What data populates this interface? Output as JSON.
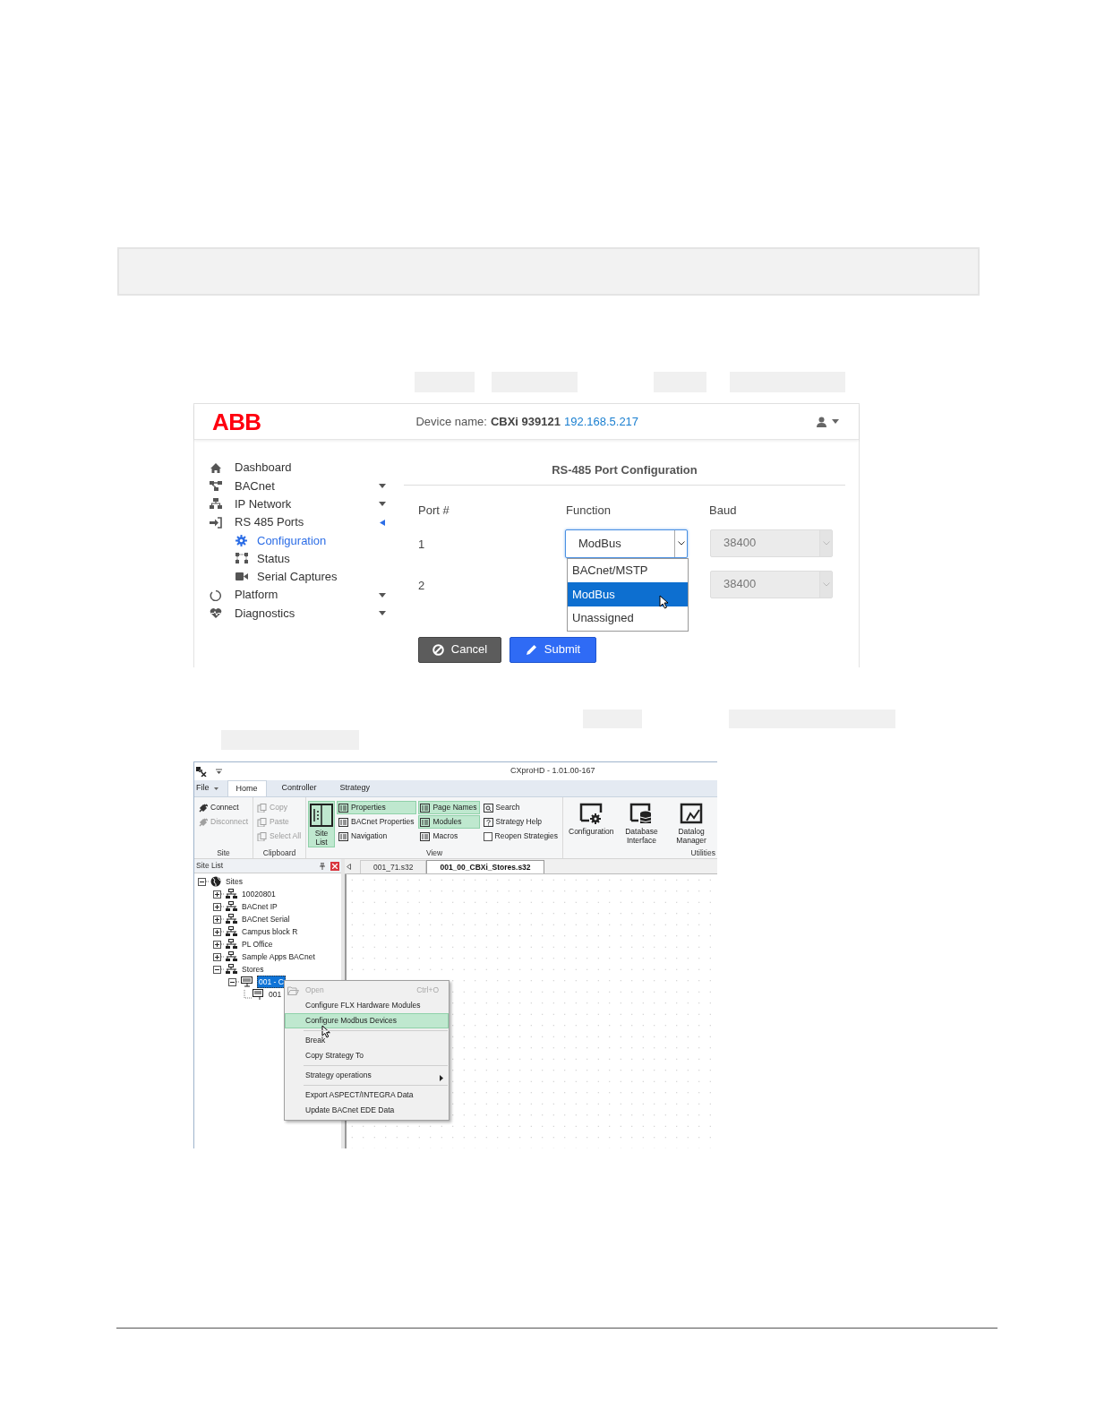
{
  "web_config": {
    "logo": "ABB",
    "header": {
      "device_label": "Device name:",
      "device_name": "CBXi 939121",
      "ip": "192.168.5.217"
    },
    "nav": [
      {
        "label": "Dashboard",
        "kind": "link",
        "selected": false
      },
      {
        "label": "BACnet",
        "kind": "group",
        "expanded": false,
        "selected": false
      },
      {
        "label": "IP Network",
        "kind": "group",
        "expanded": false,
        "selected": false
      },
      {
        "label": "RS 485 Ports",
        "kind": "group",
        "expanded": true,
        "selected": false,
        "children": [
          {
            "label": "Configuration",
            "selected": true
          },
          {
            "label": "Status",
            "selected": false
          },
          {
            "label": "Serial Captures",
            "selected": false
          }
        ]
      },
      {
        "label": "Platform",
        "kind": "group",
        "expanded": false,
        "selected": false
      },
      {
        "label": "Diagnostics",
        "kind": "group",
        "expanded": false,
        "selected": false
      }
    ],
    "title": "RS-485 Port Configuration",
    "columns": [
      "Port #",
      "Function",
      "Baud"
    ],
    "ports": [
      {
        "port": "1",
        "function": "ModBus",
        "baud": "38400",
        "dropdown_open": true
      },
      {
        "port": "2",
        "baud": "38400"
      }
    ],
    "dropdown_options": [
      {
        "label": "BACnet/MSTP",
        "selected": false
      },
      {
        "label": "ModBus",
        "selected": true
      },
      {
        "label": "Unassigned",
        "selected": false
      }
    ],
    "buttons": [
      {
        "label": "Cancel",
        "kind": "cancel"
      },
      {
        "label": "Submit",
        "kind": "submit"
      }
    ]
  },
  "cxpro": {
    "title": "CXproHD - 1.01.00-167",
    "menu_tabs": [
      {
        "label": "File",
        "selected": false
      },
      {
        "label": "Home",
        "selected": true
      },
      {
        "label": "Controller",
        "selected": false
      },
      {
        "label": "Strategy",
        "selected": false
      }
    ],
    "ribbon": [
      {
        "label": "Site",
        "columns": [
          [
            {
              "label": "Connect",
              "kind": "small",
              "disabled": false,
              "highlighted": false
            },
            {
              "label": "Disconnect",
              "kind": "small",
              "disabled": true,
              "highlighted": false
            }
          ]
        ]
      },
      {
        "label": "Clipboard",
        "columns": [
          [
            {
              "label": "Copy",
              "kind": "small",
              "disabled": true,
              "highlighted": false
            },
            {
              "label": "Paste",
              "kind": "small",
              "disabled": true,
              "highlighted": false
            },
            {
              "label": "Select All",
              "kind": "small",
              "disabled": true,
              "highlighted": false
            }
          ]
        ]
      },
      {
        "label": "View",
        "columns": [
          [
            {
              "label": "Site List",
              "kind": "large",
              "disabled": false,
              "highlighted": true
            }
          ],
          [
            {
              "label": "Properties",
              "kind": "small",
              "disabled": false,
              "highlighted": true
            },
            {
              "label": "BACnet Properties",
              "kind": "small",
              "disabled": false,
              "highlighted": false
            },
            {
              "label": "Navigation",
              "kind": "small",
              "disabled": false,
              "highlighted": false
            }
          ],
          [
            {
              "label": "Page Names",
              "kind": "small",
              "disabled": false,
              "highlighted": true
            },
            {
              "label": "Modules",
              "kind": "small",
              "disabled": false,
              "highlighted": true
            },
            {
              "label": "Macros",
              "kind": "small",
              "disabled": false,
              "highlighted": false
            }
          ],
          [
            {
              "label": "Search",
              "kind": "small",
              "disabled": false,
              "highlighted": false
            },
            {
              "label": "Strategy Help",
              "kind": "small",
              "disabled": false,
              "highlighted": false
            },
            {
              "label": "Reopen Strategies",
              "kind": "checkbox",
              "checked": false,
              "disabled": false,
              "highlighted": false
            }
          ]
        ]
      },
      {
        "label": "Utilities",
        "columns": [
          [
            {
              "label": "Configuration",
              "kind": "large",
              "disabled": false,
              "highlighted": false
            }
          ],
          [
            {
              "label": "Database Interface",
              "kind": "large",
              "disabled": false,
              "highlighted": false
            }
          ],
          [
            {
              "label": "Datalog Manager",
              "kind": "large",
              "disabled": false,
              "highlighted": false
            }
          ]
        ]
      }
    ],
    "site_list": {
      "title": "Site List",
      "tree": [
        {
          "label": "Sites",
          "kind": "node",
          "expanded": true,
          "selected": false,
          "children": [
            {
              "label": "10020801",
              "kind": "node",
              "expanded": false,
              "selected": false
            },
            {
              "label": "BACnet IP",
              "kind": "node",
              "expanded": false,
              "selected": false
            },
            {
              "label": "BACnet Serial",
              "kind": "node",
              "expanded": false,
              "selected": false
            },
            {
              "label": "Campus block R",
              "kind": "node",
              "expanded": false,
              "selected": false
            },
            {
              "label": "PL Office",
              "kind": "node",
              "expanded": false,
              "selected": false
            },
            {
              "label": "Sample Apps BACnet",
              "kind": "node",
              "expanded": false,
              "selected": false
            },
            {
              "label": "Stores",
              "kind": "node",
              "expanded": true,
              "selected": false,
              "children": [
                {
                  "label": "001 - C",
                  "kind": "node",
                  "expanded": true,
                  "selected": true,
                  "children": [
                    {
                      "label": "001",
                      "kind": "leaf",
                      "selected": false
                    }
                  ]
                }
              ]
            }
          ]
        }
      ]
    },
    "doc_tabs": [
      {
        "label": "001_71.s32",
        "selected": false
      },
      {
        "label": "001_00_CBXi_Stores.s32",
        "selected": true
      }
    ],
    "context_menu": [
      {
        "label": "Open",
        "shortcut": "Ctrl+O",
        "disabled": true,
        "highlighted": false,
        "separator_before": false,
        "submenu": false
      },
      {
        "label": "Configure FLX Hardware Modules",
        "disabled": false,
        "highlighted": false,
        "separator_before": false,
        "submenu": false
      },
      {
        "label": "Configure Modbus Devices",
        "disabled": false,
        "highlighted": true,
        "separator_before": false,
        "submenu": false
      },
      {
        "label": "Break",
        "disabled": false,
        "highlighted": false,
        "separator_before": true,
        "submenu": false
      },
      {
        "label": "Copy Strategy To",
        "disabled": false,
        "highlighted": false,
        "separator_before": false,
        "submenu": false
      },
      {
        "label": "Strategy operations",
        "disabled": false,
        "highlighted": false,
        "separator_before": true,
        "submenu": true
      },
      {
        "label": "Export ASPECT/INTEGRA Data",
        "disabled": false,
        "highlighted": false,
        "separator_before": true,
        "submenu": false
      },
      {
        "label": "Update BACnet EDE Data",
        "disabled": false,
        "highlighted": false,
        "separator_before": false,
        "submenu": false
      }
    ]
  }
}
